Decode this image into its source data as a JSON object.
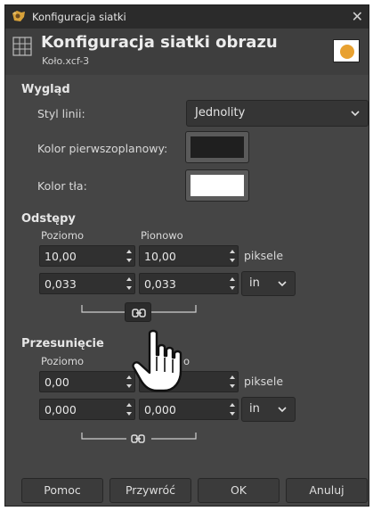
{
  "window_title": "Konfiguracja siatki",
  "header": {
    "title": "Konfiguracja siatki obrazu",
    "subtitle": "Koło.xcf-3"
  },
  "appearance": {
    "section": "Wygląd",
    "line_style_label": "Styl linii:",
    "line_style_value": "Jednolity",
    "fg_color_label": "Kolor pierwszoplanowy:",
    "bg_color_label": "Kolor tła:",
    "fg_color": "#1f1f1f",
    "bg_color": "#ffffff"
  },
  "spacing": {
    "section": "Odstępy",
    "horizontal_label": "Poziomo",
    "vertical_label": "Pionowo",
    "horizontal_px": "10,00",
    "vertical_px": "10,00",
    "unit_px": "piksele",
    "horizontal_in": "0,033",
    "vertical_in": "0,033",
    "unit_in": "in"
  },
  "offset": {
    "section": "Przesunięcie",
    "horizontal_label": "Poziomo",
    "vertical_label": "o",
    "horizontal_px": "0,00",
    "vertical_px": "",
    "unit_px": "piksele",
    "horizontal_in": "0,000",
    "vertical_in": "0,000",
    "unit_in": "in"
  },
  "buttons": {
    "help": "Pomoc",
    "reset": "Przywróć",
    "ok": "OK",
    "cancel": "Anuluj"
  },
  "colors": {
    "accent": "#e8a130"
  }
}
